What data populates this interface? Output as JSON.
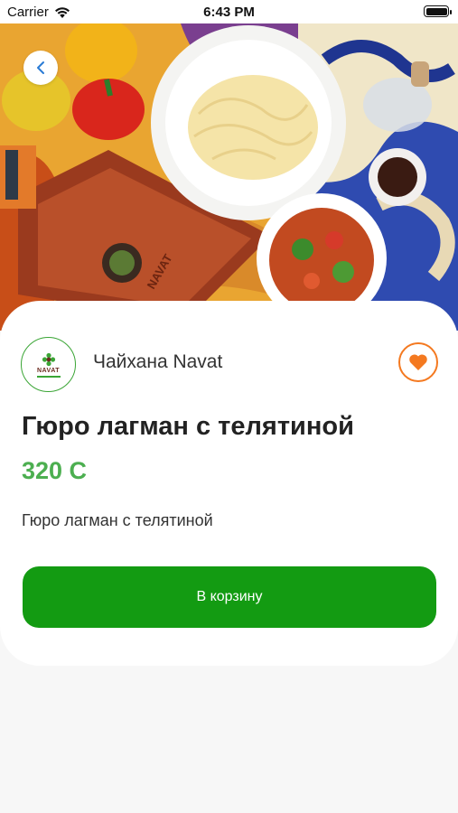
{
  "status_bar": {
    "carrier": "Carrier",
    "time": "6:43 PM"
  },
  "hero": {
    "image_alt": "Photo of lagman noodles, soup and peppers on a patterned cloth",
    "plate_brand_text": "NAVAT"
  },
  "restaurant": {
    "name": "Чайхана Navat",
    "logo_text": "NAVAT"
  },
  "product": {
    "title": "Гюро лагман с телятиной",
    "price": "320 С",
    "description": "Гюро лагман с телятиной"
  },
  "actions": {
    "add_to_cart_label": "В корзину",
    "back_icon": "chevron-left-icon",
    "favorite_icon": "heart-icon"
  },
  "colors": {
    "accent_green": "#139b12",
    "price_green": "#4caf50",
    "favorite_orange": "#f47920"
  }
}
